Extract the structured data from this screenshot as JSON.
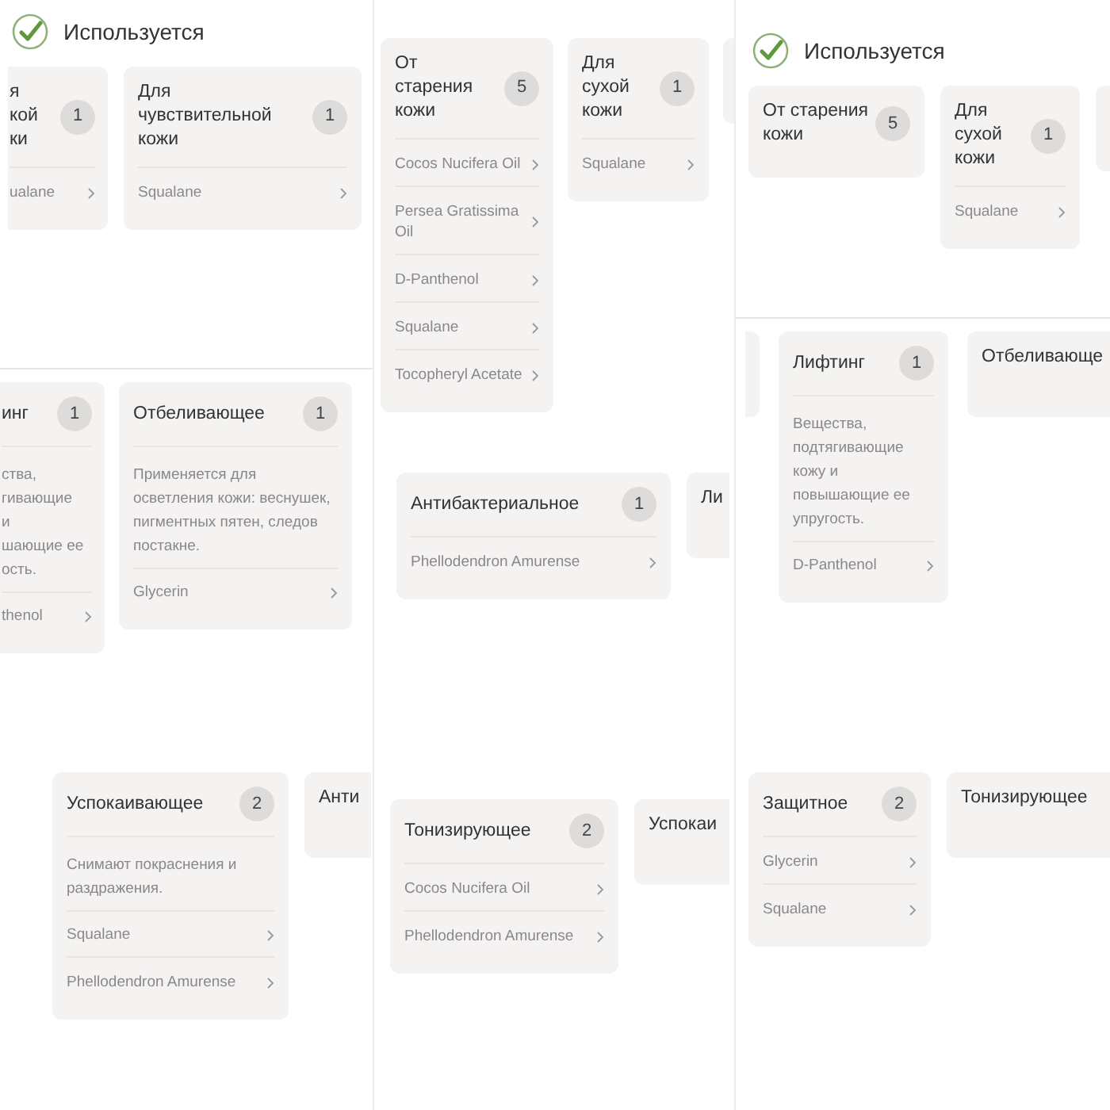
{
  "panels": [
    {
      "header": "Используется",
      "cards": [
        {
          "kind": "cutleft",
          "title": "я\nкой\nки",
          "count": "1",
          "items": [
            "ualane"
          ]
        },
        {
          "kind": "full",
          "title": "Для чувствительной кожи",
          "count": "1",
          "items": [
            "Squalane"
          ]
        }
      ]
    },
    {
      "cards": [
        {
          "kind": "full",
          "title": "От старения кожи",
          "count": "5",
          "items": [
            "Cocos Nucifera Oil",
            "Persea Gratissima Oil",
            "D-Panthenol",
            "Squalane",
            "Tocopheryl Acetate"
          ]
        },
        {
          "kind": "full",
          "title": "Для сухой кожи",
          "count": "1",
          "items": [
            "Squalane"
          ]
        },
        {
          "kind": "cutright"
        }
      ]
    },
    {
      "header": "Используется",
      "cards": [
        {
          "kind": "full",
          "title": "От старения кожи",
          "count": "5"
        },
        {
          "kind": "full",
          "title": "Для сухой кожи",
          "count": "1",
          "items": [
            "Squalane"
          ]
        },
        {
          "kind": "cutright"
        }
      ]
    },
    {
      "cards": [
        {
          "kind": "cutleft",
          "title": "инг",
          "count": "1",
          "description": "ства,\nгивающие\nи\nшающие ее\nость.",
          "items": [
            "thenol"
          ]
        },
        {
          "kind": "full",
          "title": "Отбеливающее",
          "count": "1",
          "description": "Применяется для осветления кожи: веснушек, пигментных пятен, следов постакне.",
          "items": [
            "Glycerin"
          ]
        }
      ]
    },
    {
      "cards": [
        {
          "kind": "full",
          "title": "Антибактериальное",
          "count": "1",
          "items": [
            "Phellodendron Amurense"
          ]
        },
        {
          "kind": "cutright",
          "title": "Ли"
        }
      ]
    },
    {
      "cards": [
        {
          "kind": "cutleft"
        },
        {
          "kind": "full",
          "title": "Лифтинг",
          "count": "1",
          "description": "Вещества, подтягивающие кожу и повышающие ее упругость.",
          "items": [
            "D-Panthenol"
          ]
        },
        {
          "kind": "cutright",
          "title": "Отбеливающе"
        }
      ]
    },
    {
      "cards": [
        {
          "kind": "full",
          "title": "Успокаивающее",
          "count": "2",
          "description": "Снимают покраснения и раздражения.",
          "items": [
            "Squalane",
            "Phellodendron Amurense"
          ]
        },
        {
          "kind": "cutright",
          "title": "Анти"
        }
      ]
    },
    {
      "cards": [
        {
          "kind": "full",
          "title": "Тонизирующее",
          "count": "2",
          "items": [
            "Cocos Nucifera Oil",
            "Phellodendron Amurense"
          ]
        },
        {
          "kind": "cutright",
          "title": "Успокаи"
        }
      ]
    },
    {
      "cards": [
        {
          "kind": "full",
          "title": "Защитное",
          "count": "2",
          "items": [
            "Glycerin",
            "Squalane"
          ]
        },
        {
          "kind": "cutright",
          "title": "Тонизирующее"
        }
      ]
    }
  ]
}
